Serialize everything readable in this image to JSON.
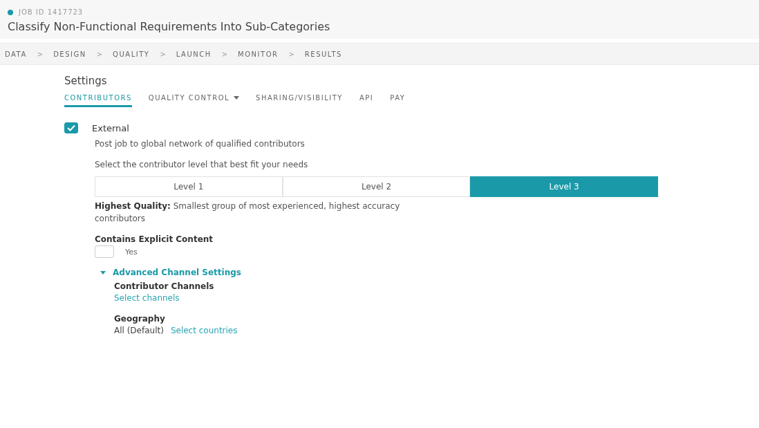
{
  "job": {
    "active": true,
    "id_label": "JOB ID 1417723",
    "title": "Classify Non-Functional Requirements Into Sub-Categories"
  },
  "breadcrumb": {
    "separator": ">",
    "steps": [
      "DATA",
      "DESIGN",
      "QUALITY",
      "LAUNCH",
      "MONITOR",
      "RESULTS"
    ]
  },
  "settings": {
    "heading": "Settings",
    "tabs": [
      {
        "label": "CONTRIBUTORS",
        "selected": true,
        "has_menu": false
      },
      {
        "label": "QUALITY CONTROL",
        "selected": false,
        "has_menu": true
      },
      {
        "label": "SHARING/VISIBILITY",
        "selected": false,
        "has_menu": false
      },
      {
        "label": "API",
        "selected": false,
        "has_menu": false
      },
      {
        "label": "PAY",
        "selected": false,
        "has_menu": false
      }
    ]
  },
  "external": {
    "label": "External",
    "checked": true,
    "description": "Post job to global network of qualified contributors"
  },
  "levels": {
    "prompt": "Select the contributor level that best fit your needs",
    "options": [
      {
        "label": "Level 1",
        "selected": false
      },
      {
        "label": "Level 2",
        "selected": false
      },
      {
        "label": "Level 3",
        "selected": true
      }
    ],
    "description": "**Highest Quality:** Smallest group of most experienced, highest accuracy contributors"
  },
  "explicit": {
    "heading": "Contains Explicit Content",
    "label": "Yes",
    "checked": false
  },
  "advanced": {
    "label": "Advanced Channel Settings",
    "expanded": true,
    "channels": {
      "heading": "Contributor Channels",
      "link": "Select channels"
    },
    "geography": {
      "heading": "Geography",
      "value": "All (Default)",
      "link": "Select countries"
    }
  }
}
